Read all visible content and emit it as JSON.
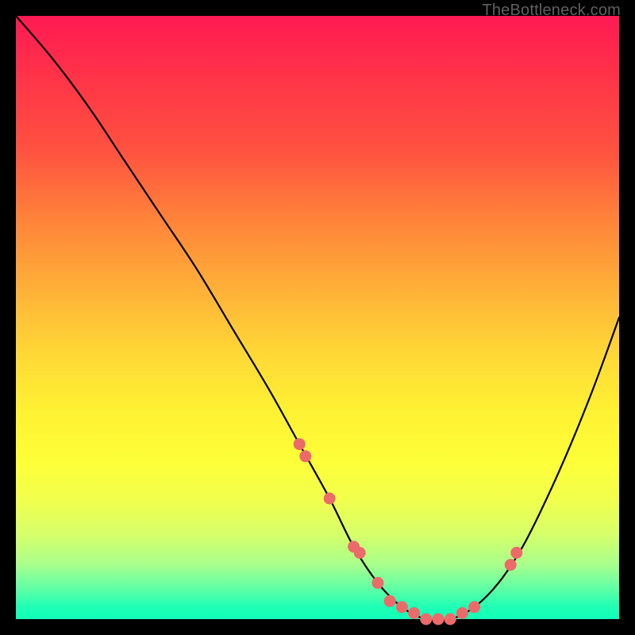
{
  "attribution": "TheBottleneck.com",
  "chart_data": {
    "type": "line",
    "title": "",
    "xlabel": "",
    "ylabel": "",
    "xlim": [
      0,
      100
    ],
    "ylim": [
      0,
      100
    ],
    "grid": false,
    "legend": false,
    "background": "red-yellow-green vertical gradient",
    "series": [
      {
        "name": "curve",
        "color": "#000000",
        "x": [
          0,
          6,
          12,
          18,
          24,
          30,
          36,
          42,
          47,
          52,
          56,
          60,
          64,
          68,
          72,
          76,
          80,
          84,
          88,
          92,
          96,
          100
        ],
        "values": [
          100,
          93,
          85,
          76,
          67,
          58,
          48,
          38,
          29,
          20,
          12,
          6,
          2,
          0,
          0,
          2,
          6,
          12,
          20,
          29,
          39,
          50
        ]
      }
    ],
    "markers": {
      "name": "highlighted-points",
      "color": "#ed6a6a",
      "x": [
        47,
        48,
        52,
        56,
        57,
        60,
        62,
        64,
        66,
        68,
        70,
        72,
        74,
        76,
        82,
        83
      ],
      "values": [
        29,
        27,
        20,
        12,
        11,
        6,
        3,
        2,
        1,
        0,
        0,
        0,
        1,
        2,
        9,
        11
      ]
    }
  }
}
